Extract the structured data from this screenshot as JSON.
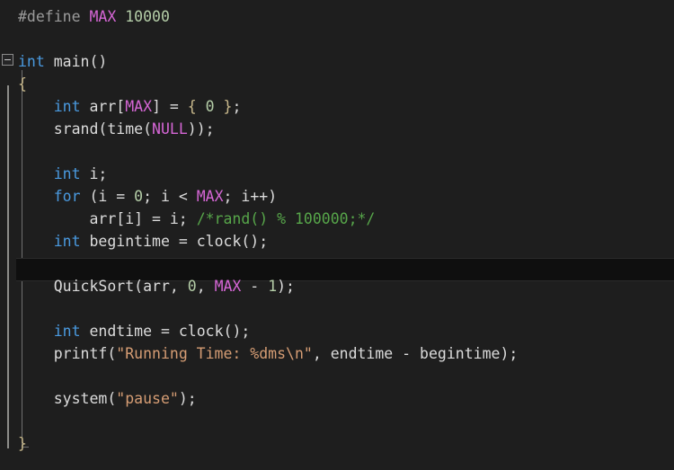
{
  "app": {
    "kind": "code-editor",
    "language": "C",
    "theme": "dark",
    "background_color": "#1e1e1e",
    "current_line_color": "#0f0f0f"
  },
  "colors": {
    "preprocessor": "#9b9b9b",
    "keyword": "#4a9ae0",
    "macro": "#d566d5",
    "number": "#b5cea8",
    "identifier": "#dcdcdc",
    "string": "#d69d74",
    "comment": "#57a64a",
    "brace": "#c9b98c",
    "change_bar": "#8d8d8a",
    "scope_guide": "#707070"
  },
  "gutter": {
    "fold_marker": "collapse-minus-box",
    "change_bar_label": "unsaved-change-indicator"
  },
  "code": {
    "current_line_index": 10,
    "lines": [
      {
        "index": 0,
        "tokens": [
          {
            "text": "#define ",
            "type": "preprocessor"
          },
          {
            "text": "MAX",
            "type": "macro"
          },
          {
            "text": " ",
            "type": "plain"
          },
          {
            "text": "10000",
            "type": "number"
          }
        ]
      },
      {
        "index": 1,
        "tokens": []
      },
      {
        "index": 2,
        "tokens": [
          {
            "text": "int",
            "type": "keyword"
          },
          {
            "text": " main()",
            "type": "identifier"
          }
        ]
      },
      {
        "index": 3,
        "tokens": [
          {
            "text": "{",
            "type": "brace"
          }
        ]
      },
      {
        "index": 4,
        "tokens": [
          {
            "text": "    ",
            "type": "plain"
          },
          {
            "text": "int",
            "type": "keyword"
          },
          {
            "text": " arr[",
            "type": "identifier"
          },
          {
            "text": "MAX",
            "type": "macro"
          },
          {
            "text": "] = ",
            "type": "identifier"
          },
          {
            "text": "{",
            "type": "brace"
          },
          {
            "text": " ",
            "type": "plain"
          },
          {
            "text": "0",
            "type": "number"
          },
          {
            "text": " ",
            "type": "plain"
          },
          {
            "text": "}",
            "type": "brace"
          },
          {
            "text": ";",
            "type": "identifier"
          }
        ]
      },
      {
        "index": 5,
        "tokens": [
          {
            "text": "    srand(time(",
            "type": "identifier"
          },
          {
            "text": "NULL",
            "type": "macro"
          },
          {
            "text": "));",
            "type": "identifier"
          }
        ]
      },
      {
        "index": 6,
        "tokens": []
      },
      {
        "index": 7,
        "tokens": [
          {
            "text": "    ",
            "type": "plain"
          },
          {
            "text": "int",
            "type": "keyword"
          },
          {
            "text": " i;",
            "type": "identifier"
          }
        ]
      },
      {
        "index": 8,
        "tokens": [
          {
            "text": "    ",
            "type": "plain"
          },
          {
            "text": "for",
            "type": "keyword"
          },
          {
            "text": " (i = ",
            "type": "identifier"
          },
          {
            "text": "0",
            "type": "number"
          },
          {
            "text": "; i < ",
            "type": "identifier"
          },
          {
            "text": "MAX",
            "type": "macro"
          },
          {
            "text": "; i++)",
            "type": "identifier"
          }
        ]
      },
      {
        "index": 9,
        "tokens": [
          {
            "text": "        arr[i] = i; ",
            "type": "identifier"
          },
          {
            "text": "/*rand() % 100000;*/",
            "type": "comment"
          }
        ]
      },
      {
        "index": 10,
        "tokens": [
          {
            "text": "    ",
            "type": "plain"
          },
          {
            "text": "int",
            "type": "keyword"
          },
          {
            "text": " begintime = clock();",
            "type": "identifier"
          }
        ]
      },
      {
        "index": 11,
        "tokens": []
      },
      {
        "index": 12,
        "tokens": [
          {
            "text": "    QuickSort(arr, ",
            "type": "identifier"
          },
          {
            "text": "0",
            "type": "number"
          },
          {
            "text": ", ",
            "type": "identifier"
          },
          {
            "text": "MAX",
            "type": "macro"
          },
          {
            "text": " - ",
            "type": "identifier"
          },
          {
            "text": "1",
            "type": "number"
          },
          {
            "text": ");",
            "type": "identifier"
          }
        ]
      },
      {
        "index": 13,
        "tokens": []
      },
      {
        "index": 14,
        "tokens": [
          {
            "text": "    ",
            "type": "plain"
          },
          {
            "text": "int",
            "type": "keyword"
          },
          {
            "text": " endtime = clock();",
            "type": "identifier"
          }
        ]
      },
      {
        "index": 15,
        "tokens": [
          {
            "text": "    printf(",
            "type": "identifier"
          },
          {
            "text": "\"Running Time: %dms\\n\"",
            "type": "string"
          },
          {
            "text": ", endtime - begintime);",
            "type": "identifier"
          }
        ]
      },
      {
        "index": 16,
        "tokens": []
      },
      {
        "index": 17,
        "tokens": [
          {
            "text": "    system(",
            "type": "identifier"
          },
          {
            "text": "\"pause\"",
            "type": "string"
          },
          {
            "text": ");",
            "type": "identifier"
          }
        ]
      },
      {
        "index": 18,
        "tokens": []
      },
      {
        "index": 19,
        "tokens": [
          {
            "text": "}",
            "type": "brace"
          }
        ]
      }
    ]
  }
}
